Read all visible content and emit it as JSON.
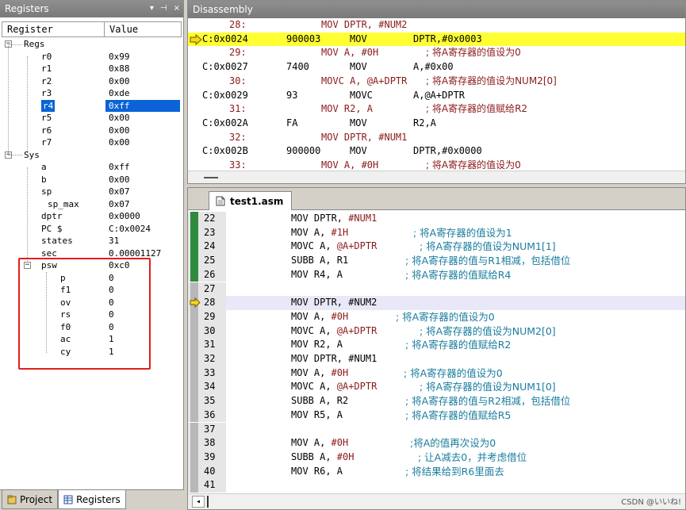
{
  "registers": {
    "title": "Registers",
    "ctrl_dropdown": "▾",
    "ctrl_pin": "⊣",
    "ctrl_close": "×",
    "col_register": "Register",
    "col_value": "Value",
    "regs_group": "Regs",
    "regs": [
      {
        "name": "r0",
        "value": "0x99"
      },
      {
        "name": "r1",
        "value": "0x88"
      },
      {
        "name": "r2",
        "value": "0x00"
      },
      {
        "name": "r3",
        "value": "0xde"
      },
      {
        "name": "r4",
        "value": "0xff"
      },
      {
        "name": "r5",
        "value": "0x00"
      },
      {
        "name": "r6",
        "value": "0x00"
      },
      {
        "name": "r7",
        "value": "0x00"
      }
    ],
    "sys_group": "Sys",
    "sys": [
      {
        "name": "a",
        "value": "0xff"
      },
      {
        "name": "b",
        "value": "0x00"
      },
      {
        "name": "sp",
        "value": "0x07"
      },
      {
        "name": "sp_max",
        "value": "0x07"
      },
      {
        "name": "dptr",
        "value": "0x0000"
      },
      {
        "name": "PC  $",
        "value": "C:0x0024"
      },
      {
        "name": "states",
        "value": "31"
      },
      {
        "name": "sec",
        "value": "0.00001127"
      }
    ],
    "psw": {
      "name": "psw",
      "value": "0xc0"
    },
    "psw_bits": [
      {
        "name": "p",
        "value": "0"
      },
      {
        "name": "f1",
        "value": "0"
      },
      {
        "name": "ov",
        "value": "0"
      },
      {
        "name": "rs",
        "value": "0"
      },
      {
        "name": "f0",
        "value": "0"
      },
      {
        "name": "ac",
        "value": "1"
      },
      {
        "name": "cy",
        "value": "1"
      }
    ],
    "tabs": {
      "project": "Project",
      "registers": "Registers"
    }
  },
  "disassembly": {
    "title": "Disassembly",
    "lines": [
      {
        "type": "src",
        "num": "28:",
        "code": "MOV DPTR, #NUM2",
        "comment": ""
      },
      {
        "type": "asm",
        "addr": "C:0x0024",
        "bytes": "900003",
        "mnem": "MOV",
        "ops": "DPTR,#0x0003",
        "current": true
      },
      {
        "type": "src",
        "num": "29:",
        "code": "MOV A, #0H",
        "comment": "; 将A寄存器的值设为0"
      },
      {
        "type": "asm",
        "addr": "C:0x0027",
        "bytes": "7400",
        "mnem": "MOV",
        "ops": "A,#0x00"
      },
      {
        "type": "src",
        "num": "30:",
        "code": "MOVC A, @A+DPTR",
        "comment": "; 将A寄存器的值设为NUM2[0]"
      },
      {
        "type": "asm",
        "addr": "C:0x0029",
        "bytes": "93",
        "mnem": "MOVC",
        "ops": "A,@A+DPTR"
      },
      {
        "type": "src",
        "num": "31:",
        "code": "MOV R2, A",
        "comment": "; 将A寄存器的值赋给R2"
      },
      {
        "type": "asm",
        "addr": "C:0x002A",
        "bytes": "FA",
        "mnem": "MOV",
        "ops": "R2,A"
      },
      {
        "type": "src",
        "num": "32:",
        "code": "MOV DPTR, #NUM1",
        "comment": ""
      },
      {
        "type": "asm",
        "addr": "C:0x002B",
        "bytes": "900000",
        "mnem": "MOV",
        "ops": "DPTR,#0x0000"
      },
      {
        "type": "src",
        "num": "33:",
        "code": "MOV A, #0H",
        "comment": "; 将A寄存器的值设为0"
      }
    ]
  },
  "editor": {
    "tab": "test1.asm",
    "lines": [
      {
        "n": "22",
        "mark": "exec",
        "code": "MOV DPTR, ",
        "imm": "#NUM1",
        "comment": ""
      },
      {
        "n": "23",
        "mark": "exec",
        "code": "MOV A, ",
        "imm": "#1H",
        "comment": "; 将A寄存器的值设为1"
      },
      {
        "n": "24",
        "mark": "exec",
        "code": "MOVC A, ",
        "imm": "@A+DPTR",
        "comment": "; 将A寄存器的值设为NUM1[1]"
      },
      {
        "n": "25",
        "mark": "exec",
        "code": "SUBB A, R1",
        "imm": "",
        "comment": "; 将A寄存器的值与R1相减，包括借位"
      },
      {
        "n": "26",
        "mark": "exec",
        "code": "MOV R4, A",
        "imm": "",
        "comment": "; 将A寄存器的值赋给R4"
      },
      {
        "n": "27",
        "mark": "nexec",
        "code": "",
        "imm": "",
        "comment": ""
      },
      {
        "n": "28",
        "mark": "nexec",
        "code": "MOV DPTR, #NUM2",
        "imm": "",
        "comment": "",
        "current": true
      },
      {
        "n": "29",
        "mark": "nexec",
        "code": "MOV A, ",
        "imm": "#0H",
        "comment": "; 将A寄存器的值设为0"
      },
      {
        "n": "30",
        "mark": "nexec",
        "code": "MOVC A, ",
        "imm": "@A+DPTR",
        "comment": "; 将A寄存器的值设为NUM2[0]"
      },
      {
        "n": "31",
        "mark": "nexec",
        "code": "MOV R2, A",
        "imm": "",
        "comment": "; 将A寄存器的值赋给R2"
      },
      {
        "n": "32",
        "mark": "nexec",
        "code": "MOV DPTR, #NUM1",
        "imm": "",
        "comment": ""
      },
      {
        "n": "33",
        "mark": "nexec",
        "code": "MOV A, ",
        "imm": "#0H",
        "comment": "; 将A寄存器的值设为0"
      },
      {
        "n": "34",
        "mark": "nexec",
        "code": "MOVC A, ",
        "imm": "@A+DPTR",
        "comment": "; 将A寄存器的值设为NUM1[0]"
      },
      {
        "n": "35",
        "mark": "nexec",
        "code": "SUBB A, R2",
        "imm": "",
        "comment": "; 将A寄存器的值与R2相减，包括借位"
      },
      {
        "n": "36",
        "mark": "nexec",
        "code": "MOV R5, A",
        "imm": "",
        "comment": "; 将A寄存器的值赋给R5"
      },
      {
        "n": "37",
        "mark": "nexec",
        "code": "",
        "imm": "",
        "comment": ""
      },
      {
        "n": "38",
        "mark": "nexec",
        "code": "MOV A, ",
        "imm": "#0H",
        "comment": ";将A的值再次设为0"
      },
      {
        "n": "39",
        "mark": "nexec",
        "code": "SUBB A, ",
        "imm": "#0H",
        "comment": "; 让A减去0，并考虑借位"
      },
      {
        "n": "40",
        "mark": "nexec",
        "code": "MOV R6, A",
        "imm": "",
        "comment": "; 将结果给到R6里面去"
      },
      {
        "n": "41",
        "mark": "nexec",
        "code": "",
        "imm": "",
        "comment": ""
      }
    ],
    "scroll_left": "◂"
  },
  "watermark": "CSDN @いいね!",
  "colors": {
    "current_line": "#ffff33",
    "selection": "#0a64d8",
    "exec_bar": "#2e8b3e",
    "highlight_box": "#e0201a"
  }
}
